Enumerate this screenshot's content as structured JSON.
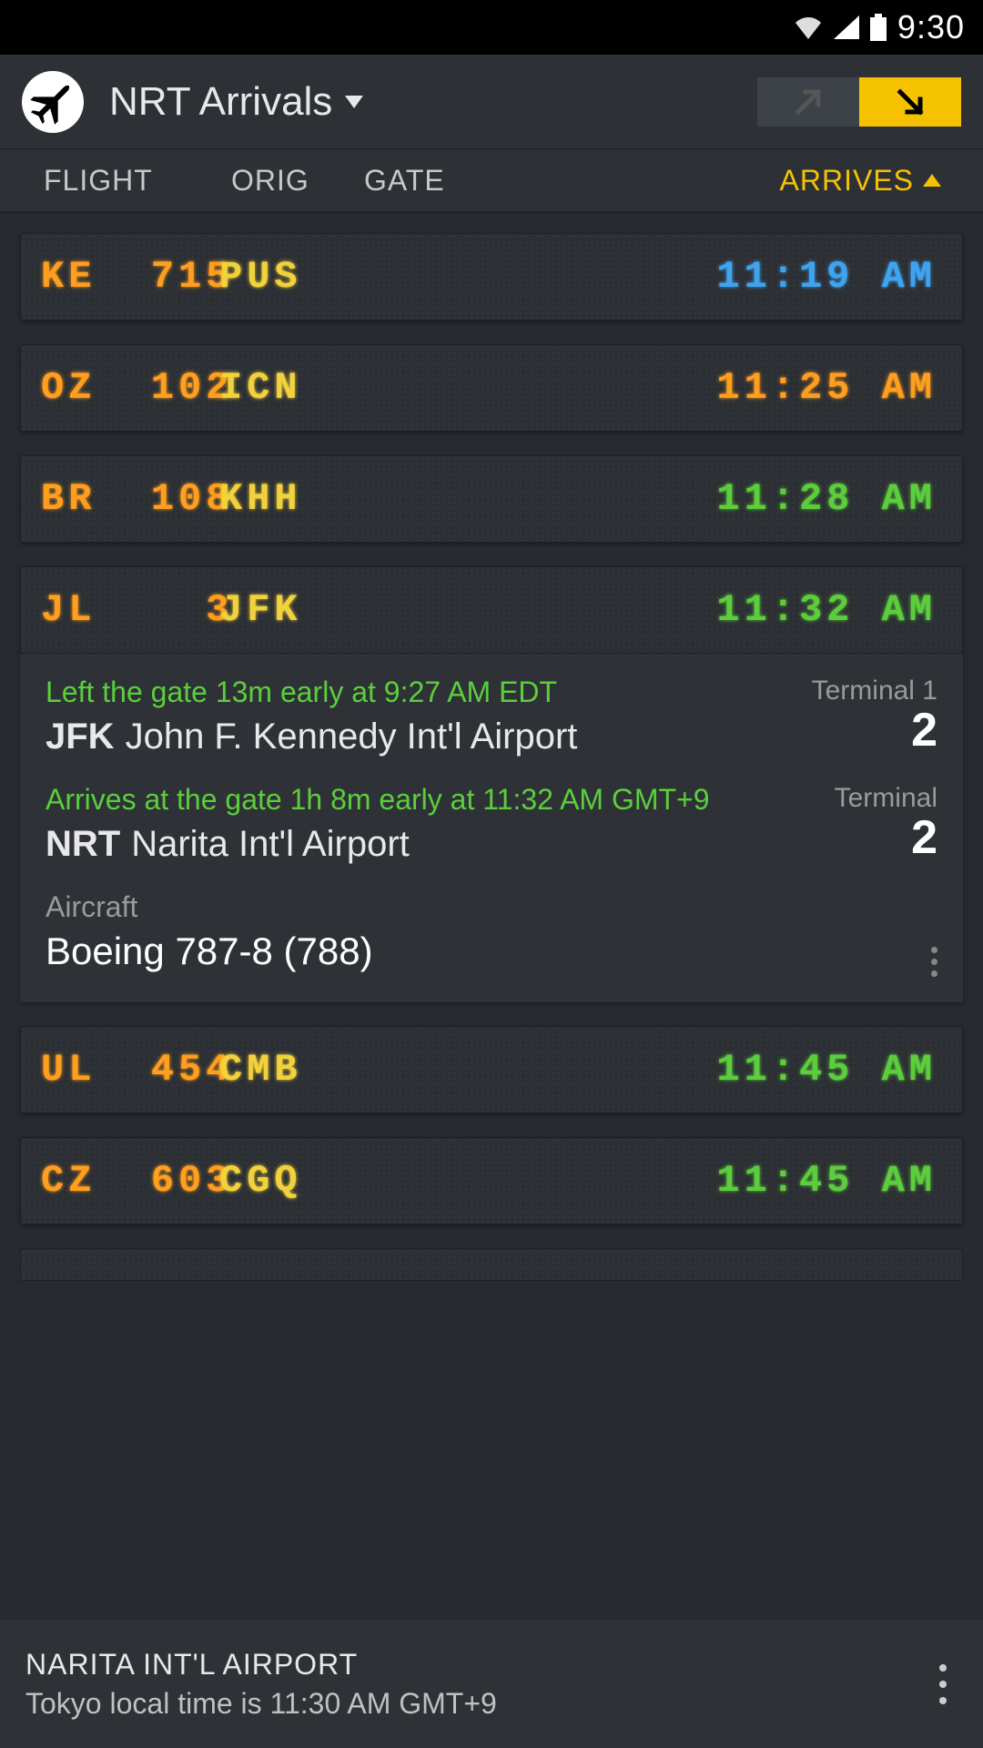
{
  "status_bar": {
    "time": "9:30"
  },
  "header": {
    "title": "NRT Arrivals"
  },
  "columns": {
    "flight": "FLIGHT",
    "orig": "ORIG",
    "gate": "GATE",
    "arrives": "ARRIVES"
  },
  "flights": [
    {
      "carrier": "KE",
      "num": "715",
      "orig": "PUS",
      "time": "11:19 AM",
      "color": "blue"
    },
    {
      "carrier": "OZ",
      "num": "102",
      "orig": "ICN",
      "time": "11:25 AM",
      "color": "orange"
    },
    {
      "carrier": "BR",
      "num": "108",
      "orig": "KHH",
      "time": "11:28 AM",
      "color": "green"
    },
    {
      "carrier": "JL",
      "num": "3",
      "orig": "JFK",
      "time": "11:32 AM",
      "color": "green"
    },
    {
      "carrier": "UL",
      "num": "454",
      "orig": "CMB",
      "time": "11:45 AM",
      "color": "green"
    },
    {
      "carrier": "CZ",
      "num": "603",
      "orig": "CGQ",
      "time": "11:45 AM",
      "color": "green"
    }
  ],
  "expanded": {
    "dep_status": "Left the gate 13m early at 9:27 AM EDT",
    "dep_code": "JFK",
    "dep_name": "John F. Kennedy Int'l Airport",
    "dep_term_label": "Terminal 1",
    "dep_term_num": "2",
    "arr_status": "Arrives at the gate 1h 8m early at 11:32 AM GMT+9",
    "arr_code": "NRT",
    "arr_name": "Narita Int'l Airport",
    "arr_term_label": "Terminal",
    "arr_term_num": "2",
    "aircraft_label": "Aircraft",
    "aircraft": "Boeing 787-8 (788)"
  },
  "footer": {
    "title": "NARITA INT'L AIRPORT",
    "sub": "Tokyo local time is 11:30 AM GMT+9"
  }
}
